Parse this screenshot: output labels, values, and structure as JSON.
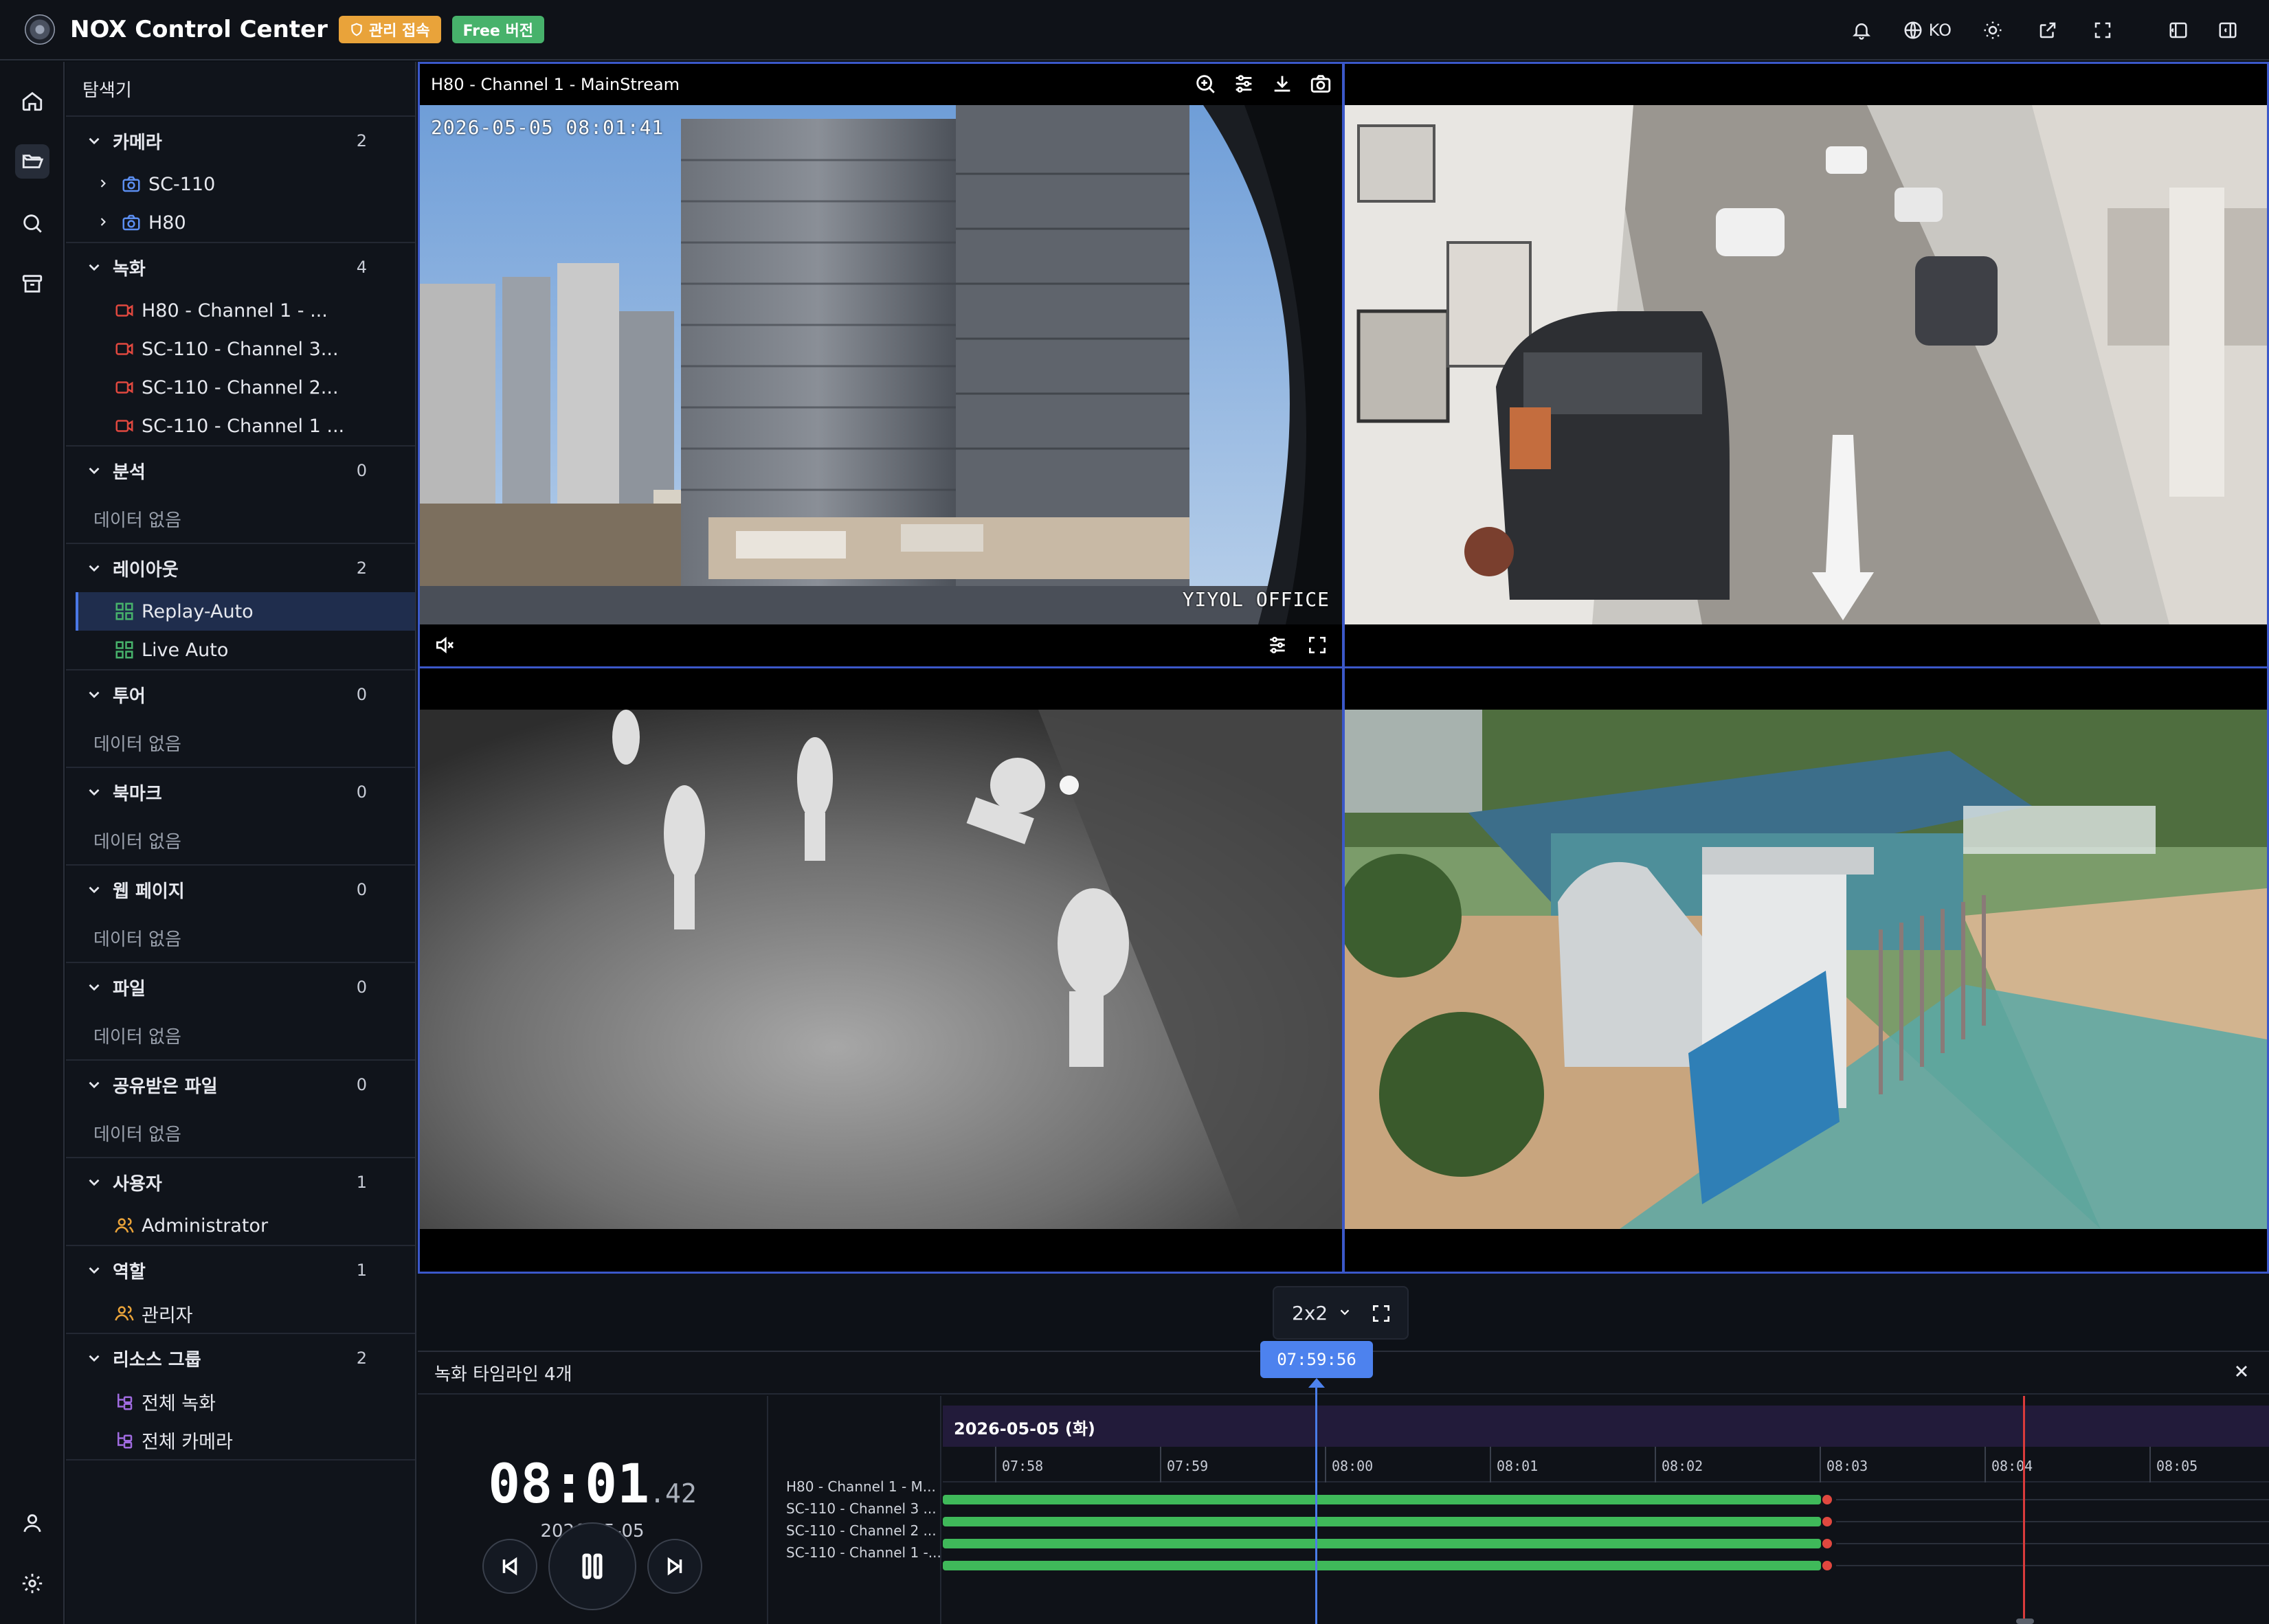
{
  "header": {
    "app_title": "NOX Control Center",
    "admin_badge": "관리 접속",
    "free_badge": "Free 버전",
    "language": "KO"
  },
  "explorer": {
    "title": "탐색기",
    "sections": {
      "camera": {
        "label": "카메라",
        "count": "2",
        "items": [
          "SC-110",
          "H80"
        ]
      },
      "recording": {
        "label": "녹화",
        "count": "4",
        "items": [
          "H80 - Channel 1 - ...",
          "SC-110 - Channel 3...",
          "SC-110 - Channel 2...",
          "SC-110 - Channel 1 ..."
        ]
      },
      "analysis": {
        "label": "분석",
        "count": "0"
      },
      "layout": {
        "label": "레이아웃",
        "count": "2",
        "items": [
          "Replay-Auto",
          "Live Auto"
        ]
      },
      "tour": {
        "label": "투어",
        "count": "0"
      },
      "bookmark": {
        "label": "북마크",
        "count": "0"
      },
      "webpage": {
        "label": "웹 페이지",
        "count": "0"
      },
      "file": {
        "label": "파일",
        "count": "0"
      },
      "shared": {
        "label": "공유받은 파일",
        "count": "0"
      },
      "user": {
        "label": "사용자",
        "count": "1",
        "items": [
          "Administrator"
        ]
      },
      "role": {
        "label": "역할",
        "count": "1",
        "items": [
          "관리자"
        ]
      },
      "resource": {
        "label": "리소스 그룹",
        "count": "2",
        "items": [
          "전체 녹화",
          "전체 카메라"
        ]
      }
    },
    "empty_text": "데이터 없음"
  },
  "grid": {
    "active_cell_title": "H80 - Channel 1 - MainStream",
    "osd_timestamp": "2026-05-05 08:01:41",
    "osd_label": "YIYOL OFFICE",
    "layout_value": "2x2"
  },
  "timeline": {
    "title": "녹화 타임라인 4개",
    "clock": "08:01",
    "clock_ms": ".42",
    "clock_date": "2026-05-05",
    "cursor_time": "07:59:56",
    "date_band": "2026-05-05 (화)",
    "ticks": [
      "07:58",
      "07:59",
      "08:00",
      "08:01",
      "08:02",
      "08:03",
      "08:04",
      "08:05"
    ],
    "tracks": [
      "H80 - Channel 1 - M...",
      "SC-110 - Channel 3 ...",
      "SC-110 - Channel 2 ...",
      "SC-110 - Channel 1 -..."
    ]
  },
  "colors": {
    "accent": "#4d82ee",
    "record_green": "#3fb95a",
    "now_red": "#d93b3b",
    "badge_admin": "#e9a33a",
    "badge_free": "#47b26b"
  }
}
